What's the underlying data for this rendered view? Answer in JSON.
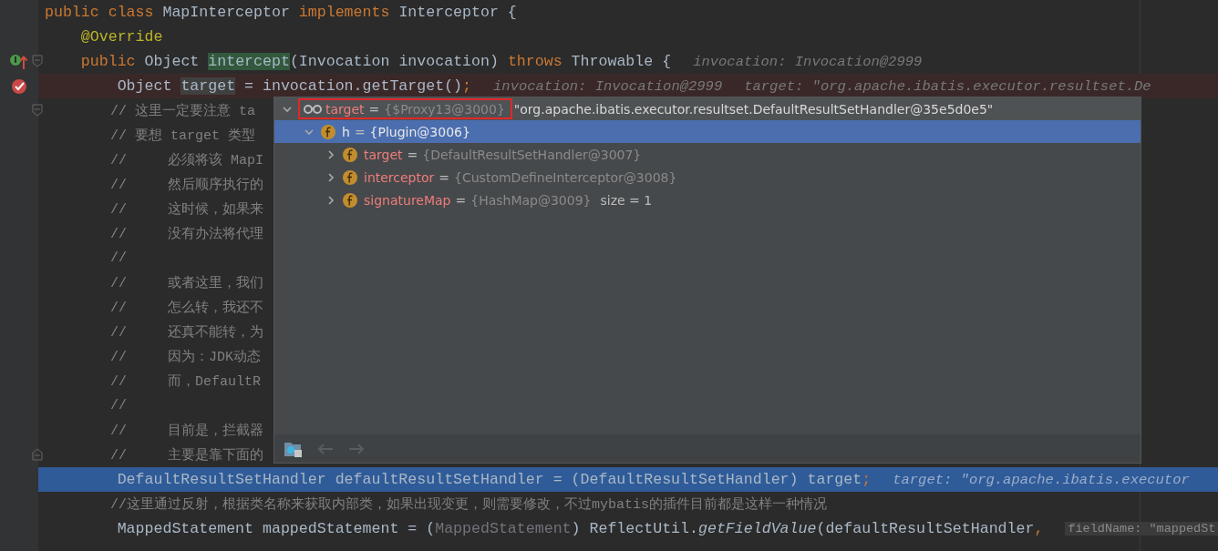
{
  "editor": {
    "lines": [
      {
        "selected": false,
        "breakpoint": false,
        "code": [
          {
            "kind": "kw",
            "text": "public class "
          },
          {
            "kind": "plain",
            "text": "MapInterceptor "
          },
          {
            "kind": "kw",
            "text": "implements "
          },
          {
            "kind": "plain",
            "text": "Interceptor {"
          }
        ]
      },
      {
        "selected": false,
        "breakpoint": false,
        "code": [
          {
            "kind": "ann",
            "text": "    @Override"
          }
        ]
      },
      {
        "selected": false,
        "breakpoint": false,
        "gutter": [
          {
            "kind": "implements"
          },
          {
            "kind": "fold_start"
          }
        ],
        "code": [
          {
            "kind": "kw",
            "text": "    public "
          },
          {
            "kind": "plain",
            "text": "Object "
          },
          {
            "kind": "match",
            "text": "intercept"
          },
          {
            "kind": "plain",
            "text": "(Invocation invocation) "
          },
          {
            "kind": "kw",
            "text": "throws "
          },
          {
            "kind": "plain",
            "text": "Throwable {"
          }
        ],
        "hints": [
          "invocation: Invocation@2999"
        ]
      },
      {
        "selected": false,
        "breakpoint": true,
        "code": [
          {
            "kind": "plain",
            "text": "        Object "
          },
          {
            "kind": "usage",
            "text": "target"
          },
          {
            "kind": "plain",
            "text": " = invocation.getTarget()"
          },
          {
            "kind": "kw",
            "text": ";"
          }
        ],
        "hints": [
          "invocation: Invocation@2999",
          "target: \"org.apache.ibatis.executor.resultset.De"
        ]
      },
      {
        "selected": false,
        "breakpoint": false,
        "gutter": [
          {
            "kind": "fold_start"
          }
        ],
        "code": [
          {
            "kind": "cm",
            "text": "        // 这里一定要注意 ta"
          }
        ]
      },
      {
        "selected": false,
        "breakpoint": false,
        "code": [
          {
            "kind": "cm",
            "text": "        // 要想 target 类型"
          }
        ]
      },
      {
        "selected": false,
        "breakpoint": false,
        "code": [
          {
            "kind": "cm",
            "text": "        //     必须将该 MapI"
          }
        ]
      },
      {
        "selected": false,
        "breakpoint": false,
        "code": [
          {
            "kind": "cm",
            "text": "        //     然后顺序执行的"
          }
        ]
      },
      {
        "selected": false,
        "breakpoint": false,
        "code": [
          {
            "kind": "cm",
            "text": "        //     这时候，如果来"
          }
        ]
      },
      {
        "selected": false,
        "breakpoint": false,
        "code": [
          {
            "kind": "cm",
            "text": "        //     没有办法将代理"
          }
        ]
      },
      {
        "selected": false,
        "breakpoint": false,
        "code": [
          {
            "kind": "cm",
            "text": "        //"
          }
        ]
      },
      {
        "selected": false,
        "breakpoint": false,
        "code": [
          {
            "kind": "cm",
            "text": "        //     或者这里，我们"
          }
        ]
      },
      {
        "selected": false,
        "breakpoint": false,
        "code": [
          {
            "kind": "cm",
            "text": "        //     怎么转，我还不"
          }
        ]
      },
      {
        "selected": false,
        "breakpoint": false,
        "code": [
          {
            "kind": "cm",
            "text": "        //     还真不能转，为"
          }
        ]
      },
      {
        "selected": false,
        "breakpoint": false,
        "code": [
          {
            "kind": "cm",
            "text": "        //     因为：JDK动态"
          }
        ]
      },
      {
        "selected": false,
        "breakpoint": false,
        "code": [
          {
            "kind": "cm",
            "text": "        //     而，DefaultR"
          }
        ]
      },
      {
        "selected": false,
        "breakpoint": false,
        "code": [
          {
            "kind": "cm",
            "text": "        //"
          }
        ]
      },
      {
        "selected": false,
        "breakpoint": false,
        "code": [
          {
            "kind": "cm",
            "text": "        //     目前是，拦截器"
          }
        ]
      },
      {
        "selected": false,
        "breakpoint": false,
        "gutter": [
          {
            "kind": "fold_end"
          }
        ],
        "code": [
          {
            "kind": "cm",
            "text": "        //     主要是靠下面的"
          }
        ]
      },
      {
        "selected": true,
        "breakpoint": false,
        "code": [
          {
            "kind": "plain",
            "text": "        DefaultResultSetHandler defaultResultSetHandler = (DefaultResultSetHandler) target"
          },
          {
            "kind": "kw",
            "text": ";"
          }
        ],
        "hints": [
          "target: \"org.apache.ibatis.executor"
        ]
      },
      {
        "selected": false,
        "breakpoint": false,
        "code": [
          {
            "kind": "cm",
            "text": "        //这里通过反射，根据类名称来获取内部类，如果出现变更，则需要修改，不过mybatis的插件目前都是这样一种情况"
          }
        ]
      },
      {
        "selected": false,
        "breakpoint": false,
        "code": [
          {
            "kind": "plain",
            "text": "        MappedStatement mappedStatement = ("
          },
          {
            "kind": "dim",
            "text": "MappedStatement"
          },
          {
            "kind": "plain",
            "text": ") ReflectUtil."
          },
          {
            "kind": "ital",
            "text": "getFieldValue"
          },
          {
            "kind": "plain",
            "text": "(defaultResultSetHandler"
          },
          {
            "kind": "kw",
            "text": ", "
          }
        ],
        "param_hint": "fieldName: \"mappedSt"
      }
    ]
  },
  "popup": {
    "tree": [
      {
        "kind": "watch",
        "name": "target",
        "op": "=",
        "type": "{$Proxy13@3000}",
        "value": "\"org.apache.ibatis.executor.resultset.DefaultResultSetHandler@35e5d0e5\"",
        "highlighted": true,
        "expanded": true,
        "selected": false,
        "children": [
          {
            "kind": "field",
            "name": "h",
            "op": "=",
            "type": "{Plugin@3006}",
            "highlighted": false,
            "expanded": true,
            "selected": true,
            "children": [
              {
                "kind": "field",
                "name": "target",
                "op": "=",
                "type": "{DefaultResultSetHandler@3007}",
                "highlighted": false,
                "expanded": false,
                "selected": false
              },
              {
                "kind": "field",
                "name": "interceptor",
                "op": "=",
                "type": "{CustomDefineInterceptor@3008}",
                "highlighted": false,
                "expanded": false,
                "selected": false
              },
              {
                "kind": "field",
                "name": "signatureMap",
                "op": "=",
                "type": "{HashMap@3009}",
                "extra": "size = 1",
                "highlighted": false,
                "expanded": false,
                "selected": false
              }
            ]
          }
        ]
      }
    ],
    "nav": [
      {
        "kind": "back",
        "disabled": true
      },
      {
        "kind": "forward",
        "disabled": true
      }
    ]
  }
}
